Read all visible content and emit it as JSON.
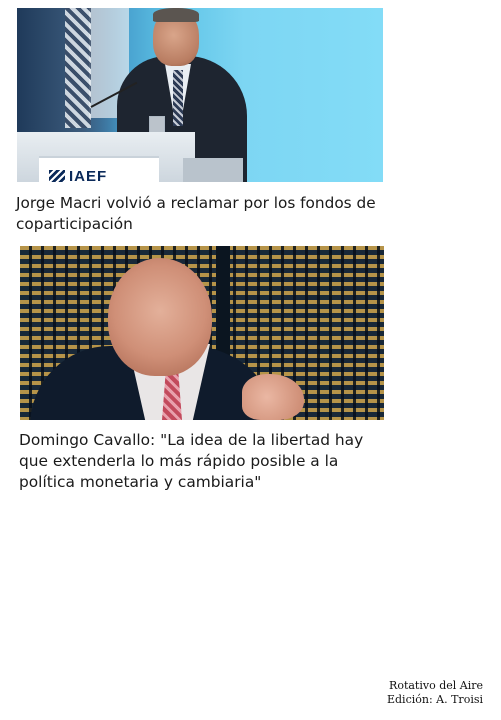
{
  "articles": [
    {
      "headline": "Jorge Macri volvió a reclamar por los fondos de coparticipación",
      "photo_logo_text": "IAEF"
    },
    {
      "headline": "Domingo Cavallo: \"La idea de la libertad hay que extenderla lo más rápido posible a la política monetaria y cambiaria\""
    }
  ],
  "credit": {
    "line1": "Rotativo del Aire",
    "line2": "Edición: A. Troisi"
  }
}
